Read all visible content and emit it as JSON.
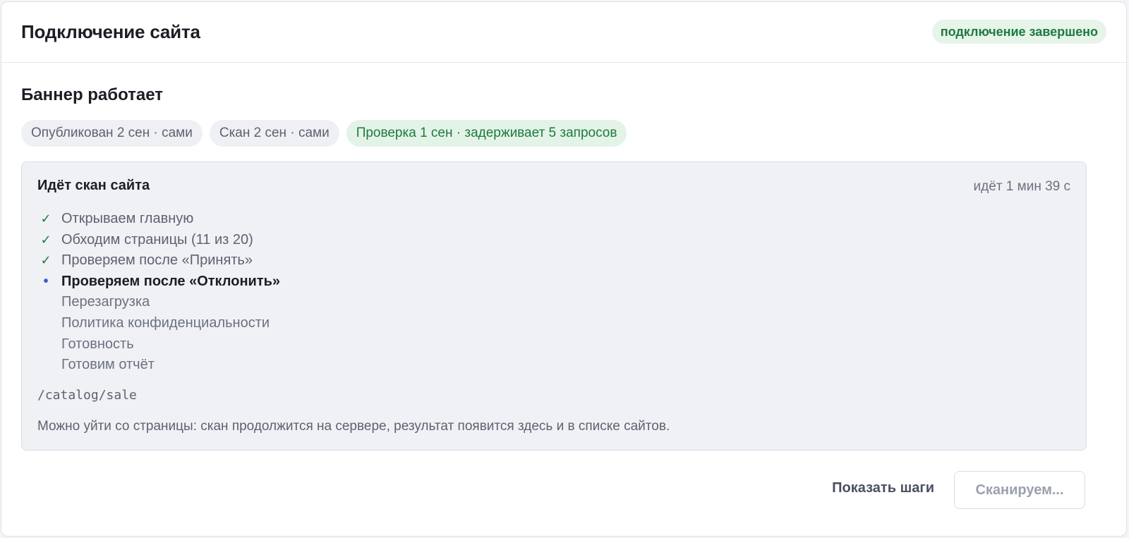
{
  "header": {
    "title": "Подключение сайта",
    "status_badge": "подключение завершено",
    "status_color": "#1e7a3e"
  },
  "banner": {
    "title": "Баннер работает",
    "chips": [
      "Опубликован 2 сен · сами",
      "Скан 2 сен · сами",
      "Проверка 1 сен · задерживает 5 запросов"
    ]
  },
  "scan": {
    "title": "Идёт скан сайта",
    "elapsed": "идёт 1 мин 39 с",
    "steps": [
      {
        "label": "Открываем главную",
        "state": "done",
        "icon": "check-icon"
      },
      {
        "label": "Обходим страницы (11 из 20)",
        "state": "done",
        "icon": "check-icon"
      },
      {
        "label": "Проверяем после «Принять»",
        "state": "done",
        "icon": "check-icon"
      },
      {
        "label": "Проверяем после «Отклонить»",
        "state": "active",
        "icon": "dot-icon"
      },
      {
        "label": "Перезагрузка",
        "state": "pending"
      },
      {
        "label": "Политика конфиденциальности",
        "state": "pending"
      },
      {
        "label": "Готовность",
        "state": "pending"
      },
      {
        "label": "Готовим отчёт",
        "state": "pending"
      }
    ],
    "current_path": "/catalog/sale",
    "note": "Можно уйти со страницы: скан продолжится на сервере, результат появится здесь и в списке сайтов."
  },
  "footer": {
    "show_steps_label": "Показать шаги",
    "scan_button_label": "Сканируем..."
  },
  "colors": {
    "accent_green": "#1e7a3e",
    "active_dot": "#3a5bd9"
  }
}
